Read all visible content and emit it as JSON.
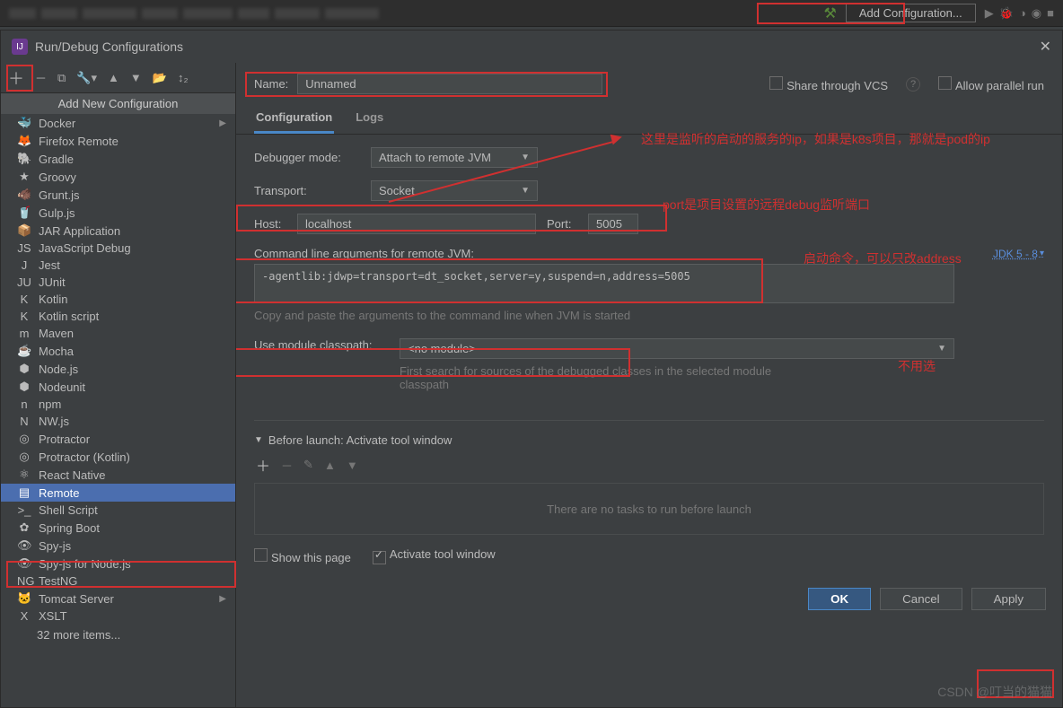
{
  "ideTop": {
    "addConf": "Add Configuration..."
  },
  "dialog": {
    "title": "Run/Debug Configurations"
  },
  "side": {
    "popupTitle": "Add New Configuration",
    "items": [
      {
        "label": "Docker",
        "icon": "🐳",
        "arrow": true
      },
      {
        "label": "Firefox Remote",
        "icon": "🦊"
      },
      {
        "label": "Gradle",
        "icon": "🐘"
      },
      {
        "label": "Groovy",
        "icon": "★"
      },
      {
        "label": "Grunt.js",
        "icon": "🐗"
      },
      {
        "label": "Gulp.js",
        "icon": "🥤"
      },
      {
        "label": "JAR Application",
        "icon": "📦"
      },
      {
        "label": "JavaScript Debug",
        "icon": "JS"
      },
      {
        "label": "Jest",
        "icon": "J"
      },
      {
        "label": "JUnit",
        "icon": "JU"
      },
      {
        "label": "Kotlin",
        "icon": "K"
      },
      {
        "label": "Kotlin script",
        "icon": "K"
      },
      {
        "label": "Maven",
        "icon": "m"
      },
      {
        "label": "Mocha",
        "icon": "☕"
      },
      {
        "label": "Node.js",
        "icon": "⬢"
      },
      {
        "label": "Nodeunit",
        "icon": "⬢"
      },
      {
        "label": "npm",
        "icon": "n"
      },
      {
        "label": "NW.js",
        "icon": "N"
      },
      {
        "label": "Protractor",
        "icon": "◎"
      },
      {
        "label": "Protractor (Kotlin)",
        "icon": "◎"
      },
      {
        "label": "React Native",
        "icon": "⚛"
      },
      {
        "label": "Remote",
        "icon": "▤",
        "selected": true
      },
      {
        "label": "Shell Script",
        "icon": ">_"
      },
      {
        "label": "Spring Boot",
        "icon": "✿"
      },
      {
        "label": "Spy-js",
        "icon": "👁"
      },
      {
        "label": "Spy-js for Node.js",
        "icon": "👁"
      },
      {
        "label": "TestNG",
        "icon": "NG"
      },
      {
        "label": "Tomcat Server",
        "icon": "🐱",
        "arrow": true
      },
      {
        "label": "XSLT",
        "icon": "X"
      }
    ],
    "more": "32 more items..."
  },
  "topRow": {
    "nameLabel": "Name:",
    "nameValue": "Unnamed",
    "shareVcs": "Share through VCS",
    "allowParallel": "Allow parallel run"
  },
  "tabs": {
    "configuration": "Configuration",
    "logs": "Logs"
  },
  "form": {
    "debuggerModeLabel": "Debugger mode:",
    "debuggerModeValue": "Attach to remote JVM",
    "transportLabel": "Transport:",
    "transportValue": "Socket",
    "hostLabel": "Host:",
    "hostValue": "localhost",
    "portLabel": "Port:",
    "portValue": "5005",
    "cmdLabel": "Command line arguments for remote JVM:",
    "jdkLink": "JDK 5 - 8",
    "cmdValue": "-agentlib:jdwp=transport=dt_socket,server=y,suspend=n,address=5005",
    "cmdHint": "Copy and paste the arguments to the command line when JVM is started",
    "clspathLabel": "Use module classpath:",
    "clspathValue": "<no module>",
    "clspathHint": "First search for sources of the debugged classes in the selected module classpath",
    "beforeLaunchHeader": "Before launch: Activate tool window",
    "noTasks": "There are no tasks to run before launch",
    "showThisPage": "Show this page",
    "activateTool": "Activate tool window"
  },
  "footer": {
    "ok": "OK",
    "cancel": "Cancel",
    "apply": "Apply"
  },
  "annotations": {
    "hostNote": "这里是监听的启动的服务的ip，如果是k8s项目，那就是pod的ip",
    "portNote": "port是项目设置的远程debug监听端口",
    "cmdNote": "启动命令，可以只改address",
    "clspathNote": "不用选"
  },
  "watermark": "CSDN @叮当的猫猫"
}
